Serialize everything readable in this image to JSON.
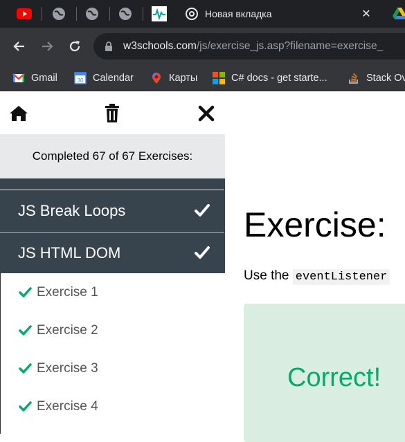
{
  "browser": {
    "tabs": [
      {
        "icon": "youtube-icon"
      },
      {
        "icon": "globe-icon"
      },
      {
        "icon": "globe-icon"
      },
      {
        "icon": "globe-icon"
      },
      {
        "icon": "activity-icon"
      }
    ],
    "active_tab": {
      "title": "Новая вкладка",
      "icon": "chrome-icon"
    },
    "address": {
      "host": "w3schools.com",
      "path": "/js/exercise_js.asp?filename=exercise_"
    },
    "bookmarks": [
      {
        "label": "Gmail",
        "icon": "gmail-icon"
      },
      {
        "label": "Calendar",
        "icon": "calendar-icon"
      },
      {
        "label": "Карты",
        "icon": "maps-icon"
      },
      {
        "label": "C# docs - get starte...",
        "icon": "microsoft-icon"
      },
      {
        "label": "Stack Ov",
        "icon": "stackoverflow-icon"
      }
    ]
  },
  "sidebar": {
    "completed_text": "Completed 67 of 67 Exercises:",
    "sections": [
      {
        "label": "JS Break Loops",
        "done": true
      },
      {
        "label": "JS HTML DOM",
        "done": true
      }
    ],
    "exercises": [
      {
        "label": "Exercise 1",
        "done": true
      },
      {
        "label": "Exercise 2",
        "done": true
      },
      {
        "label": "Exercise 3",
        "done": true
      },
      {
        "label": "Exercise 4",
        "done": true
      }
    ]
  },
  "main": {
    "heading": "Exercise:",
    "instruction_prefix": "Use the",
    "instruction_code": "eventListener",
    "result_text": "Correct!"
  },
  "colors": {
    "section_bg": "#38444d",
    "check_green": "#04aa6d",
    "result_bg": "#d9eee1"
  }
}
